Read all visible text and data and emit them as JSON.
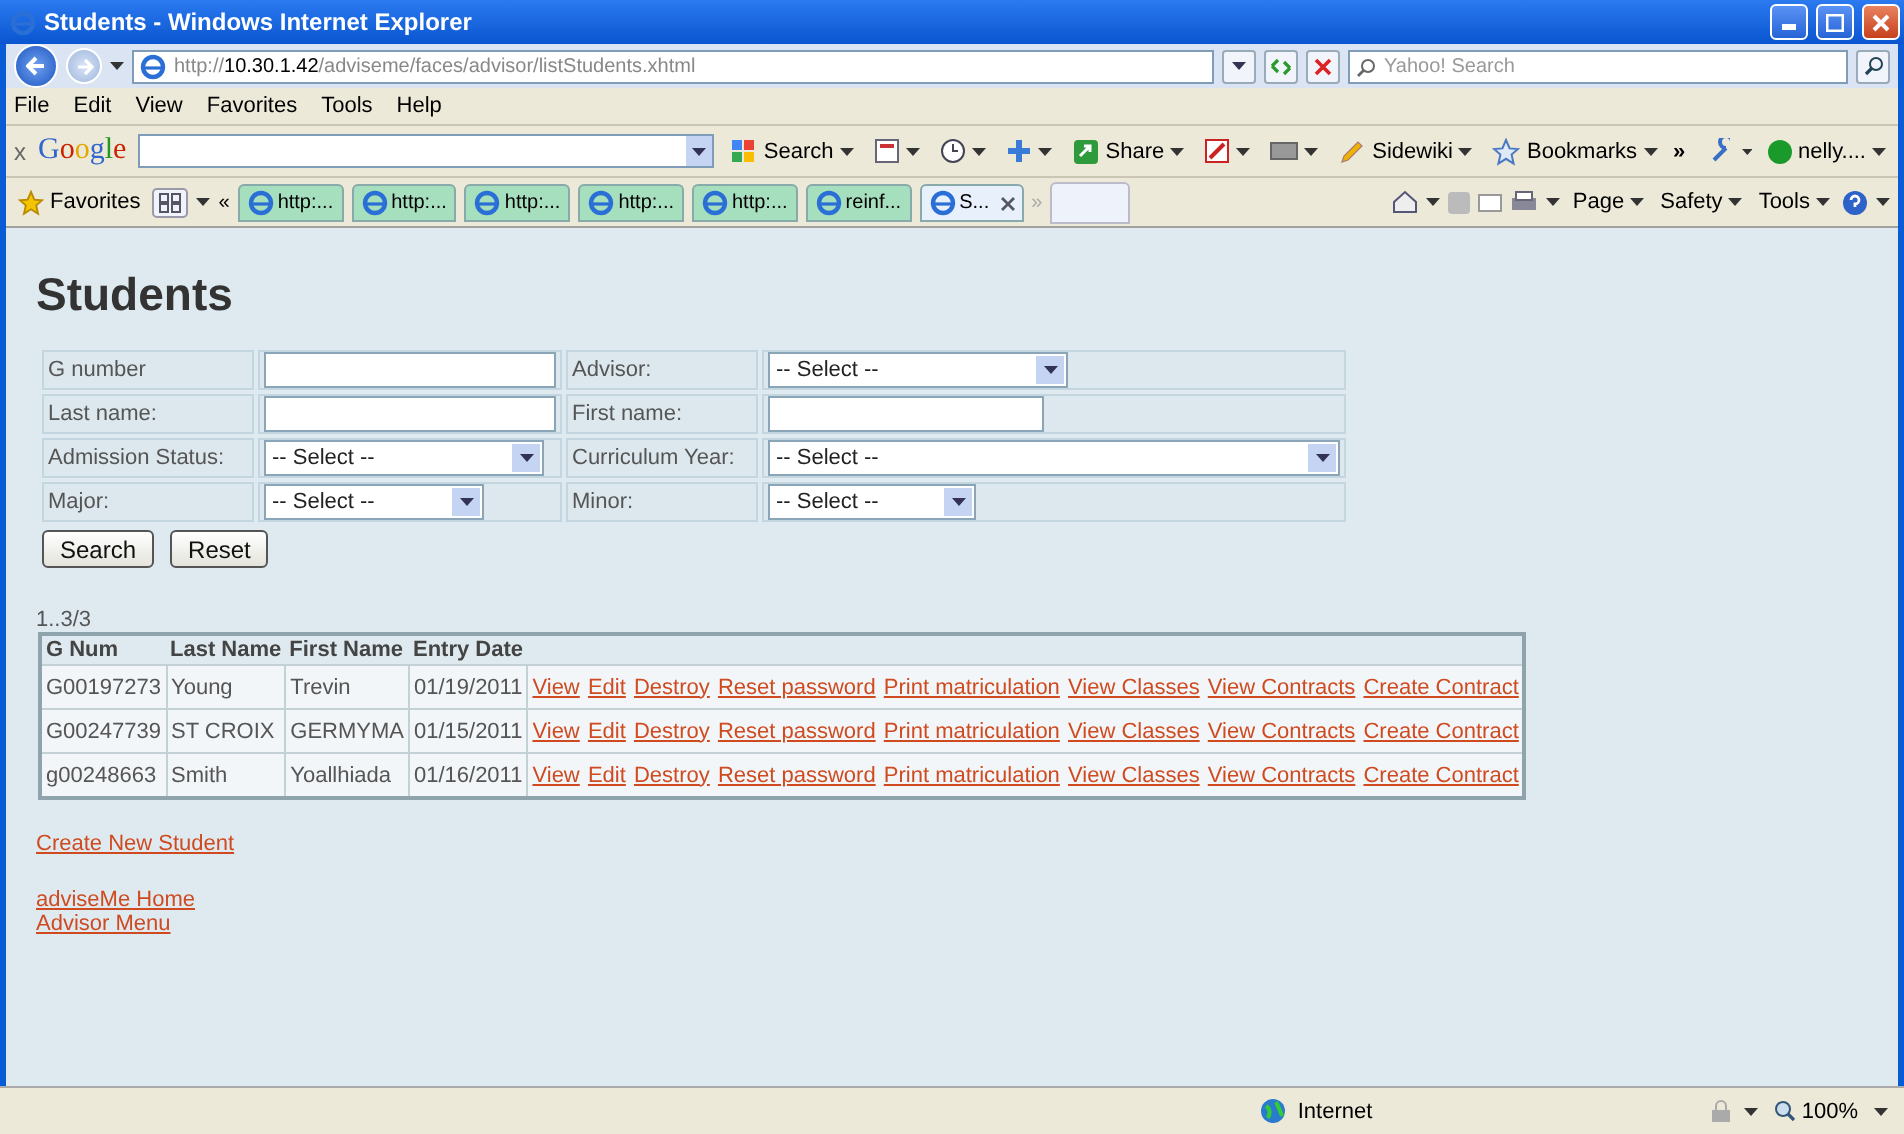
{
  "window": {
    "title": "Students - Windows Internet Explorer"
  },
  "address_bar": {
    "scheme": "http://",
    "host": "10.30.1.42",
    "path": "/adviseme/faces/advisor/listStudents.xhtml",
    "search_placeholder": "Yahoo! Search"
  },
  "menu": [
    "File",
    "Edit",
    "View",
    "Favorites",
    "Tools",
    "Help"
  ],
  "google_toolbar": {
    "close": "x",
    "logo": "Google",
    "items": [
      {
        "kind": "labeled",
        "label": "Search"
      },
      {
        "kind": "icon"
      },
      {
        "kind": "icon"
      },
      {
        "kind": "icon"
      },
      {
        "kind": "labeled",
        "label": "Share"
      },
      {
        "kind": "icon"
      },
      {
        "kind": "icon"
      },
      {
        "kind": "labeled",
        "label": "Sidewiki"
      },
      {
        "kind": "labeled",
        "label": "Bookmarks"
      }
    ],
    "more": "»",
    "user": "nelly...."
  },
  "favorites_bar": {
    "label": "Favorites",
    "back": "«",
    "tabs": [
      {
        "label": "http:...",
        "selected": false
      },
      {
        "label": "http:...",
        "selected": false
      },
      {
        "label": "http:...",
        "selected": false
      },
      {
        "label": "http:...",
        "selected": false
      },
      {
        "label": "http:...",
        "selected": false
      },
      {
        "label": "reinf...",
        "selected": false
      },
      {
        "label": "S...",
        "selected": true
      }
    ],
    "more": "»",
    "commands": [
      "Page",
      "Safety",
      "Tools"
    ]
  },
  "page": {
    "heading": "Students",
    "search_form": {
      "rows": [
        [
          {
            "label": "G number",
            "kind": "text"
          },
          {
            "label": "Advisor:",
            "kind": "select",
            "value": "-- Select --"
          }
        ],
        [
          {
            "label": "Last name:",
            "kind": "text"
          },
          {
            "label": "First name:",
            "kind": "text"
          }
        ],
        [
          {
            "label": "Admission Status:",
            "kind": "select",
            "value": "-- Select --"
          },
          {
            "label": "Curriculum Year:",
            "kind": "select",
            "value": "-- Select --"
          }
        ],
        [
          {
            "label": "Major:",
            "kind": "select",
            "value": "-- Select --"
          },
          {
            "label": "Minor:",
            "kind": "select",
            "value": "-- Select --"
          }
        ]
      ],
      "buttons": [
        "Search",
        "Reset"
      ]
    },
    "pager": "1..3/3",
    "table": {
      "columns": [
        "G Num",
        "Last Name",
        "First Name",
        "Entry Date"
      ],
      "rows": [
        {
          "cells": [
            "G00197273",
            "Young",
            "Trevin",
            "01/19/2011"
          ],
          "links": [
            "View",
            "Edit",
            "Destroy",
            "Reset password",
            "Print matriculation",
            "View Classes",
            "View Contracts",
            "Create Contract"
          ]
        },
        {
          "cells": [
            "G00247739",
            "ST CROIX",
            "GERMYMA",
            "01/15/2011"
          ],
          "links": [
            "View",
            "Edit",
            "Destroy",
            "Reset password",
            "Print matriculation",
            "View Classes",
            "View Contracts",
            "Create Contract"
          ]
        },
        {
          "cells": [
            "g00248663",
            "Smith",
            "Yoallhiada",
            "01/16/2011"
          ],
          "links": [
            "View",
            "Edit",
            "Destroy",
            "Reset password",
            "Print matriculation",
            "View Classes",
            "View Contracts",
            "Create Contract"
          ]
        }
      ]
    },
    "create_link": "Create New Student",
    "nav_links": [
      "adviseMe Home",
      "Advisor Menu"
    ]
  },
  "status_bar": {
    "zone": "Internet",
    "zoom": "100%"
  }
}
